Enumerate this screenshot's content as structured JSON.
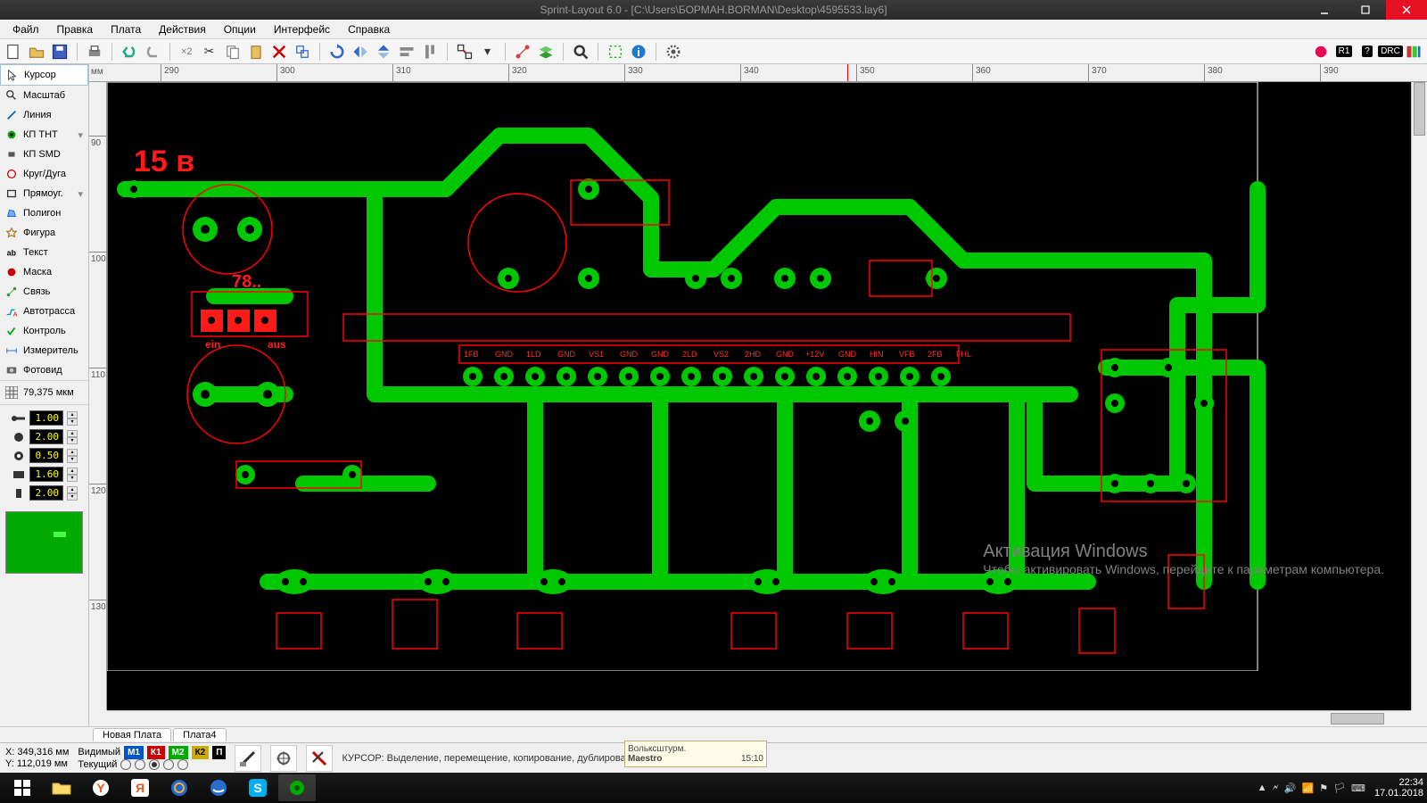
{
  "title": "Sprint-Layout 6.0 - [C:\\Users\\БОРМАН.BORMAN\\Desktop\\4595533.lay6]",
  "menu": {
    "file": "Файл",
    "edit": "Правка",
    "board": "Плата",
    "actions": "Действия",
    "options": "Опции",
    "interface": "Интерфейс",
    "help": "Справка"
  },
  "toolbar_right": {
    "r1": "R1",
    "help": "?",
    "drc": "DRC"
  },
  "tools": {
    "cursor": "Курсор",
    "zoom": "Масштаб",
    "line": "Линия",
    "tht": "КП THT",
    "smd": "КП SMD",
    "arc": "Круг/Дуга",
    "rect": "Прямоуг.",
    "poly": "Полигон",
    "shape": "Фигура",
    "text": "Текст",
    "mask": "Маска",
    "conn": "Связь",
    "auto": "Автотрасса",
    "check": "Контроль",
    "measure": "Измеритель",
    "photo": "Фотовид"
  },
  "grid_value": "79,375 мкм",
  "params": {
    "p1": "1.00",
    "p2": "2.00",
    "p3": "0.50",
    "p4": "1.60",
    "p5": "2.00"
  },
  "ruler": {
    "unit": "мм",
    "top": [
      "290",
      "300",
      "310",
      "320",
      "330",
      "340",
      "350",
      "360",
      "370",
      "380",
      "390"
    ],
    "left": [
      "90",
      "100",
      "110",
      "120",
      "130"
    ]
  },
  "pcb_labels": {
    "voltage": "15 в",
    "reg": "78..",
    "ein": "ein",
    "aus": "aus",
    "pins": [
      "1FB",
      "GND",
      "1LD",
      "GND",
      "VS1",
      "GND",
      "GND",
      "2LD",
      "VS2",
      "2HD",
      "GND",
      "+12V",
      "GND",
      "HIN",
      "VFB",
      "2FB",
      "FHL"
    ]
  },
  "tabs": {
    "t1": "Новая Плата",
    "t2": "Плата4"
  },
  "status": {
    "x_label": "X:",
    "x_val": "349,316 мм",
    "y_label": "Y:",
    "y_val": "112,019 мм",
    "visible": "Видимый",
    "current": "Текущий",
    "layers": {
      "m1": "М1",
      "k1": "К1",
      "m2": "М2",
      "k2": "К2",
      "p": "П"
    },
    "hint": "КУРСОР: Выделение, перемещение, копирование, дублирование, вставка и удаление"
  },
  "activation": {
    "t1": "Активация Windows",
    "t2": "Чтобы активировать Windows, перейдите к параметрам компьютера."
  },
  "taskbar": {
    "preview_title": "Волькcштурм.",
    "preview_sub": "Maestro",
    "preview_time": "15:10",
    "time": "22:34",
    "date": "17.01.2018"
  }
}
